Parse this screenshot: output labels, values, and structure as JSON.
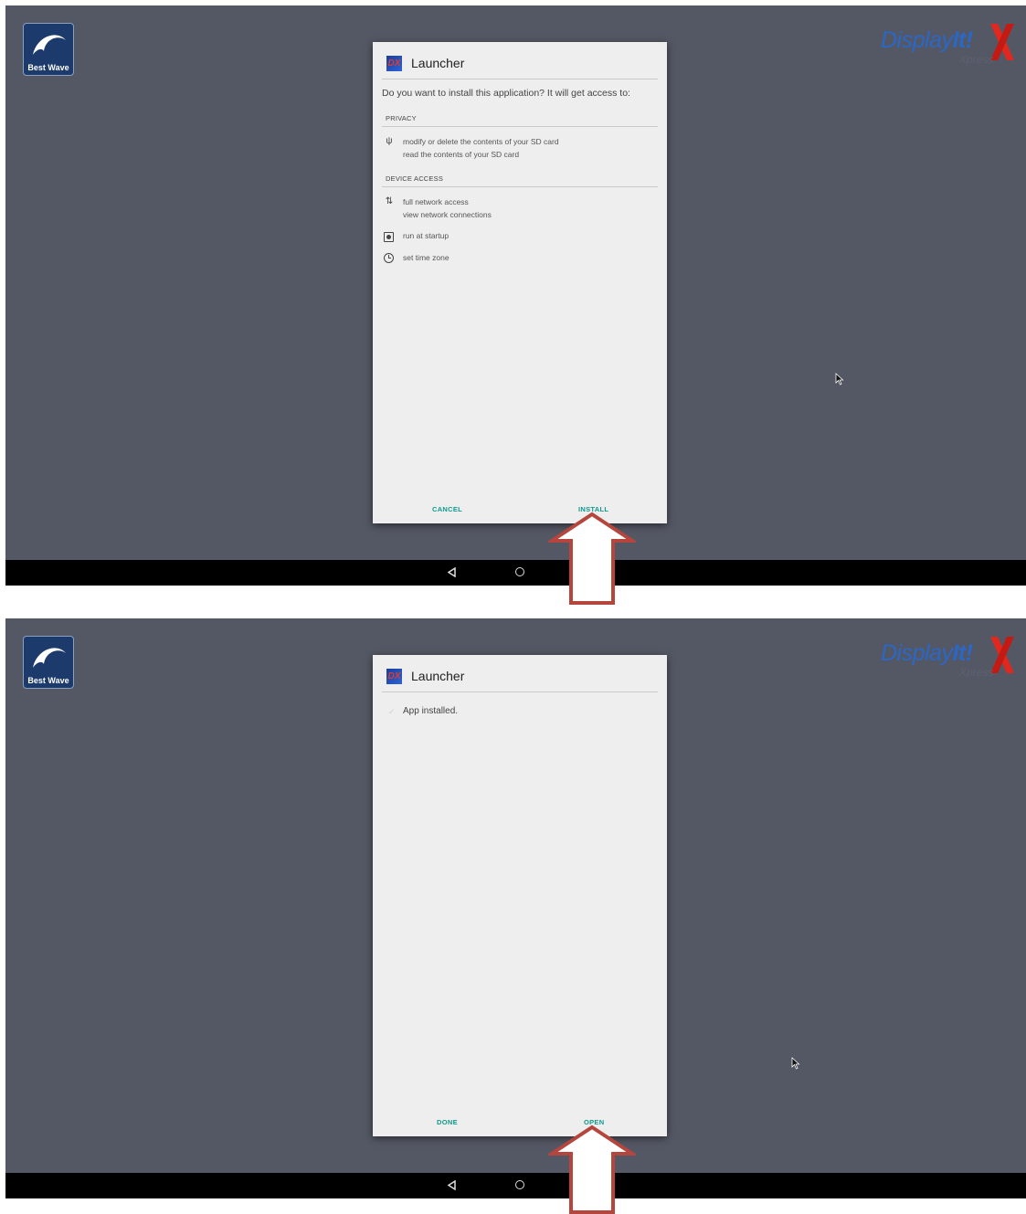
{
  "screens": [
    {
      "dialog": {
        "title": "Launcher",
        "icon_text": "DX",
        "question": "Do you want to install this application? It will get access to:",
        "privacy_header": "PRIVACY",
        "privacy_line1": "modify or delete the contents of your SD card",
        "privacy_line2": "read the contents of your SD card",
        "device_header": "DEVICE ACCESS",
        "network_line1": "full network access",
        "network_line2": "view network connections",
        "startup": "run at startup",
        "timezone": "set time zone",
        "cancel_label": "CANCEL",
        "install_label": "INSTALL"
      }
    },
    {
      "dialog": {
        "title": "Launcher",
        "icon_text": "DX",
        "message": "App installed.",
        "done_label": "DONE",
        "open_label": "OPEN"
      }
    }
  ],
  "branding": {
    "bestwave": "Best Wave",
    "display_prefix": "Display",
    "display_bold": "It!",
    "display_sub": "Xpress"
  },
  "colors": {
    "desktop": "#545864",
    "dialog": "#eeeeee",
    "accent": "#0e9a8e",
    "arrow": "#b5463e"
  },
  "icons": [
    "usb-icon",
    "network-arrows-icon",
    "startup-icon",
    "clock-icon",
    "back-icon",
    "home-icon",
    "up-arrow-annotation"
  ]
}
